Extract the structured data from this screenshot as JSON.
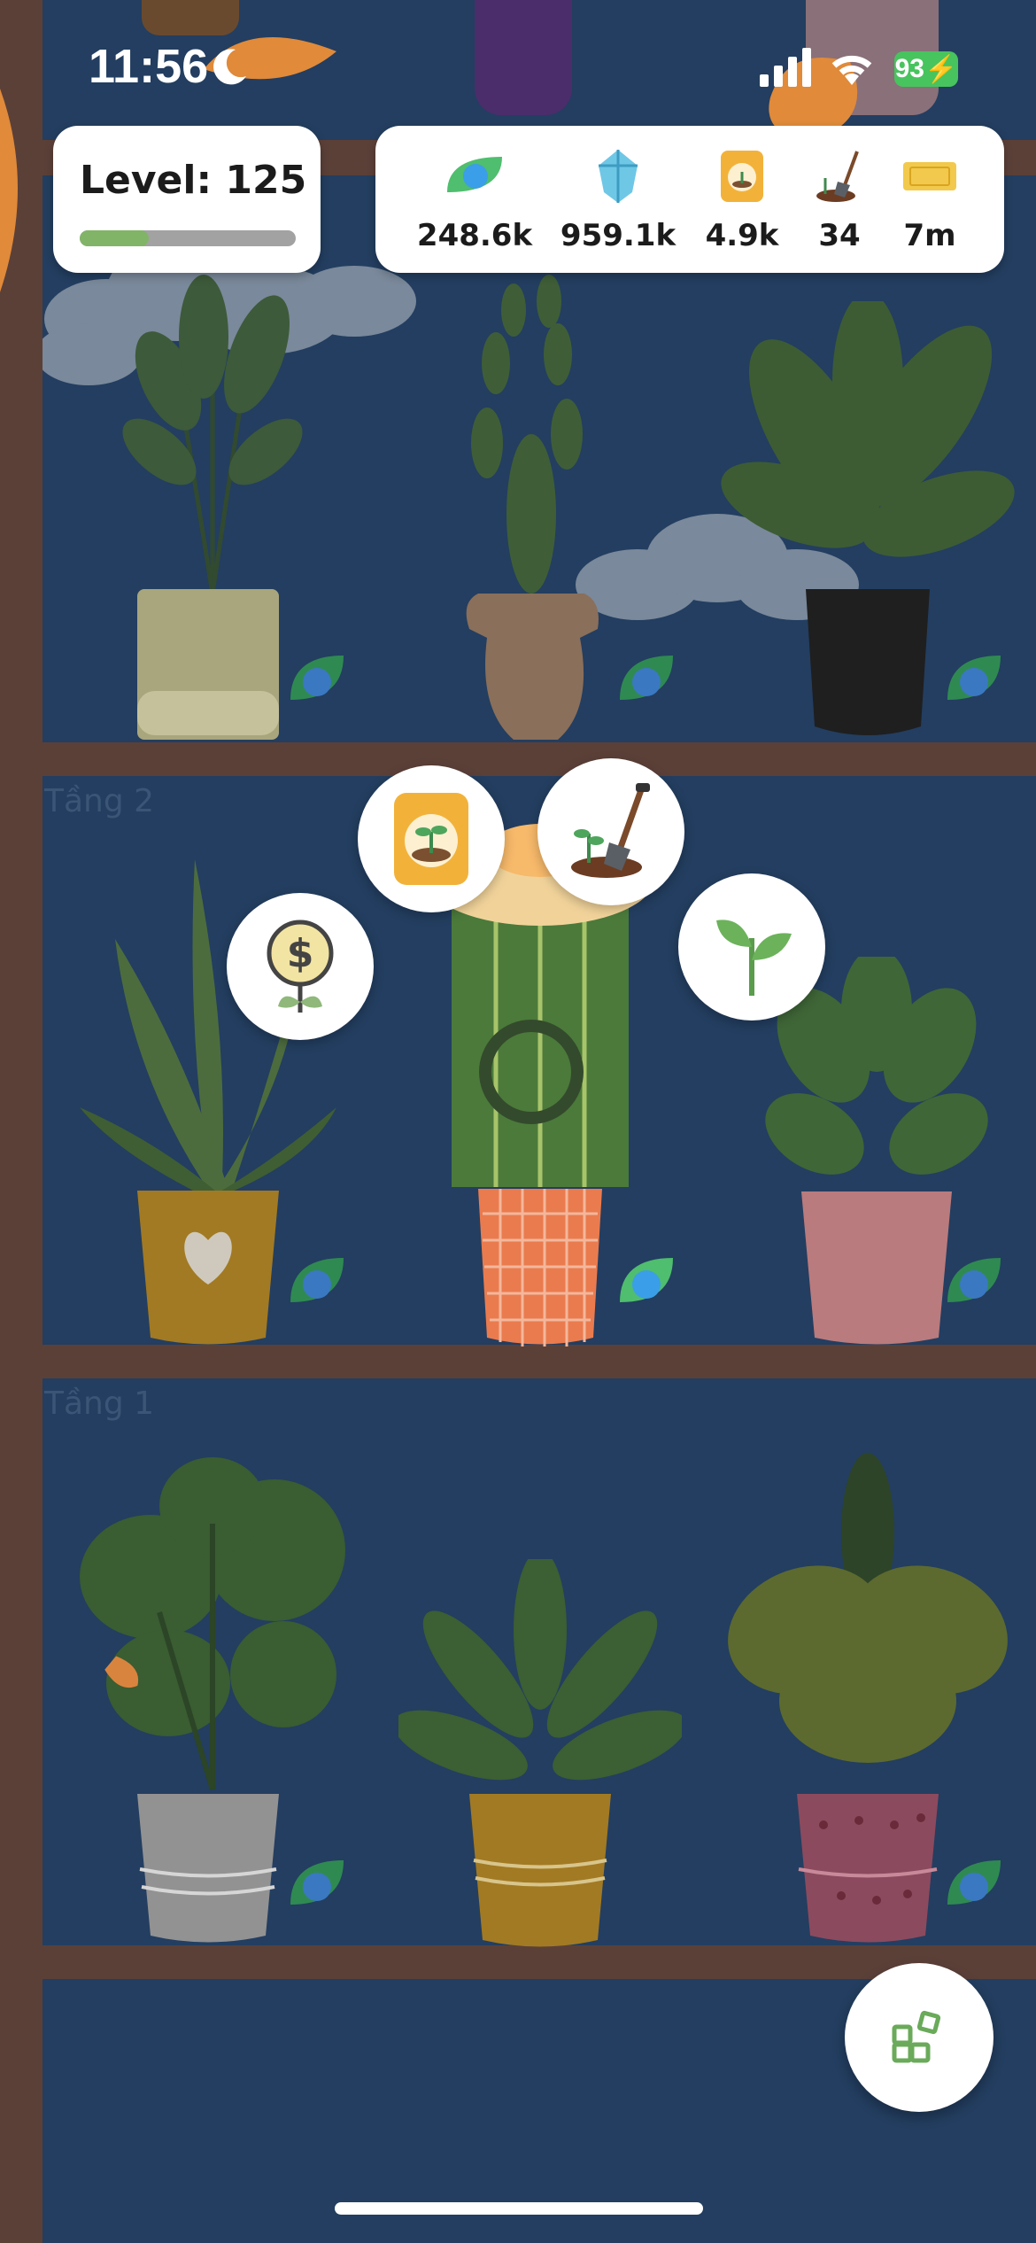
{
  "status_bar": {
    "time": "11:56",
    "battery": "93"
  },
  "level": {
    "label": "Level: 125",
    "progress": 0.32
  },
  "resources": [
    {
      "icon": "oxygen-leaf-icon",
      "value": "248.6k"
    },
    {
      "icon": "crystal-icon",
      "value": "959.1k"
    },
    {
      "icon": "seed-bag-icon",
      "value": "4.9k"
    },
    {
      "icon": "shovel-icon",
      "value": "34"
    },
    {
      "icon": "golden-ticket-icon",
      "value": "7m"
    }
  ],
  "floors": [
    {
      "label": "Tầng 2"
    },
    {
      "label": "Tầng 1"
    }
  ],
  "actions": [
    {
      "icon": "sell-plant-icon"
    },
    {
      "icon": "seed-bag-icon"
    },
    {
      "icon": "shovel-icon"
    },
    {
      "icon": "sprout-icon"
    }
  ],
  "menu_icon": "grid-menu-icon",
  "colors": {
    "background": "#233e60",
    "shelf": "#5b4038",
    "accent": "#82b467",
    "battery": "#47c45e"
  }
}
